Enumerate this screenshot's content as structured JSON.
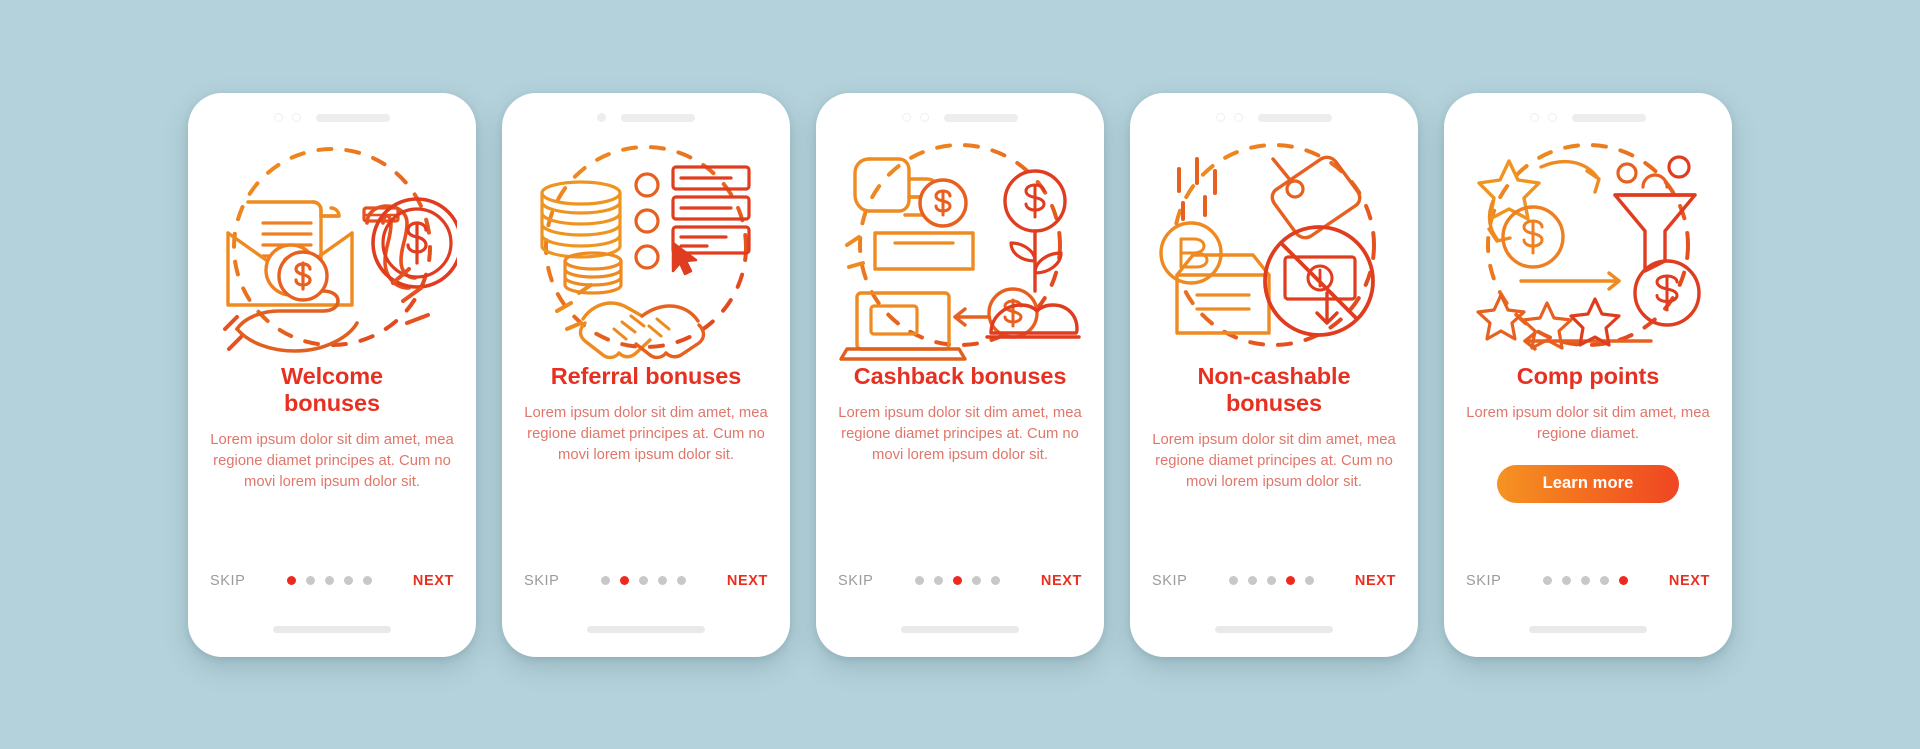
{
  "background_color": "#b4d2db",
  "theme": {
    "title_color": "#e63122",
    "body_color": "#e0766a",
    "skip_color": "#9b9b9b",
    "next_color": "#e63122",
    "dot_active_color": "#ec2a20",
    "dot_inactive_color": "#c8c8c8",
    "button_gradient_from": "#f59322",
    "button_gradient_to": "#ef4623",
    "illustration_from": "#f0951f",
    "illustration_to": "#e03c1f"
  },
  "common": {
    "skip_label": "SKIP",
    "next_label": "NEXT",
    "dot_count": 5
  },
  "screens": [
    {
      "id": "welcome-bonuses",
      "title": "Welcome bonuses",
      "title_two_line": true,
      "body": "Lorem ipsum dolor sit dim amet, mea regione diamet principes at. Cum no movi lorem ipsum dolor sit.",
      "active_dot": 0,
      "notch": "ring-ring-bar",
      "illustration": "envelope-letter-coin-horseshoe-hand",
      "has_button": false,
      "button_label": ""
    },
    {
      "id": "referral-bonuses",
      "title": "Referral bonuses",
      "title_two_line": false,
      "body": "Lorem ipsum dolor sit dim amet, mea regione diamet principes at. Cum no movi lorem ipsum dolor sit.",
      "active_dot": 1,
      "notch": "dot-bar",
      "illustration": "coins-checklist-handshake",
      "has_button": false,
      "button_label": ""
    },
    {
      "id": "cashback-bonuses",
      "title": "Cashback bonuses",
      "title_two_line": false,
      "body": "Lorem ipsum dolor sit dim amet, mea regione diamet principes at. Cum no movi lorem ipsum dolor sit.",
      "active_dot": 2,
      "notch": "ring-ring-bar",
      "illustration": "hand-coin-slot-laptop-plant",
      "has_button": false,
      "button_label": ""
    },
    {
      "id": "non-cashable-bonuses",
      "title": "Non-cashable bonuses",
      "title_two_line": true,
      "body": "Lorem ipsum dolor sit dim amet, mea regione diamet principes at. Cum no movi lorem ipsum dolor sit.",
      "active_dot": 3,
      "notch": "ring-ring-bar",
      "illustration": "bonus-box-tag-no-cash",
      "has_button": false,
      "button_label": ""
    },
    {
      "id": "comp-points",
      "title": "Comp points",
      "title_two_line": false,
      "body": "Lorem ipsum dolor sit dim amet, mea regione diamet.",
      "active_dot": 4,
      "notch": "ring-ring-bar",
      "illustration": "stars-coin-funnel-arrows",
      "has_button": true,
      "button_label": "Learn more"
    }
  ]
}
